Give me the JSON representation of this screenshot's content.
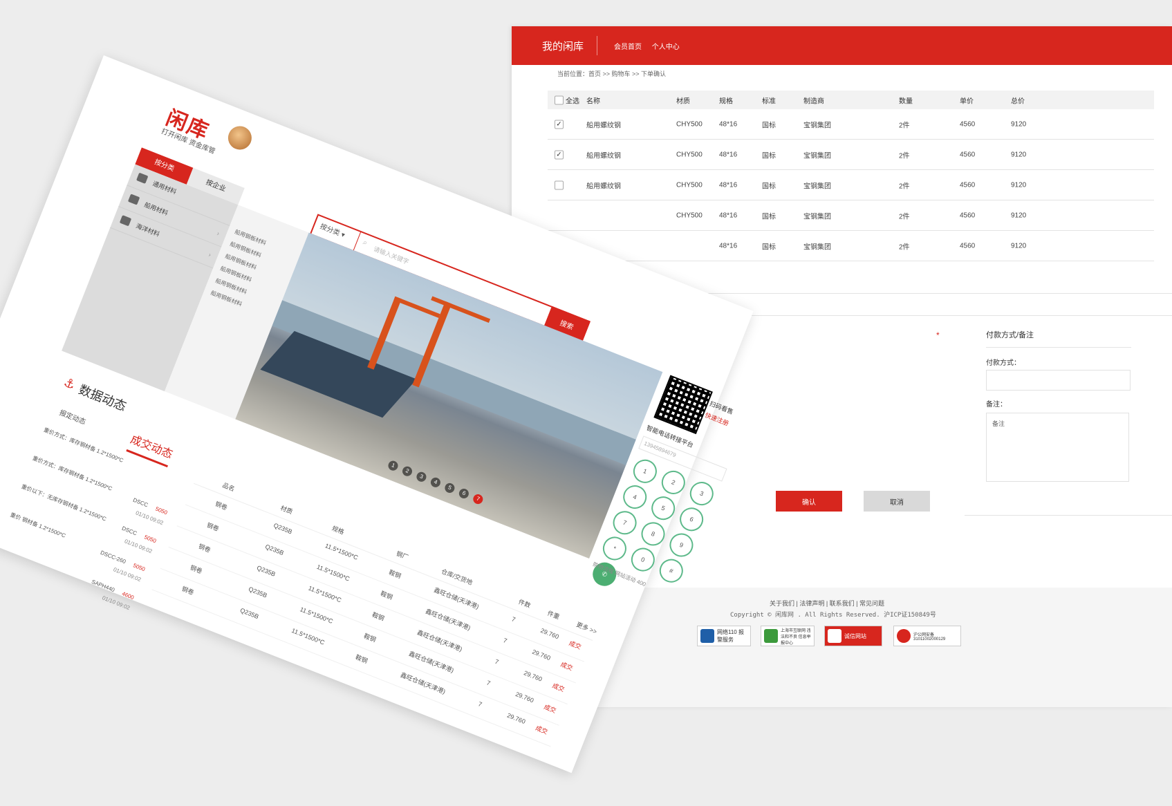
{
  "back": {
    "brand": "我的闲库",
    "nav": [
      "会员首页",
      "个人中心"
    ],
    "breadcrumb": "当前位置：首页 >> 购物车 >> 下单确认",
    "table": {
      "select_all": "全选",
      "headers": [
        "名称",
        "材质",
        "规格",
        "标准",
        "制造商",
        "数量",
        "单价",
        "总价"
      ],
      "rows": [
        {
          "checked": true,
          "name": "船用螺纹钢",
          "material": "CHY500",
          "spec": "48*16",
          "standard": "国标",
          "maker": "宝钢集团",
          "qty": "2件",
          "price": "4560",
          "total": "9120"
        },
        {
          "checked": true,
          "name": "船用螺纹钢",
          "material": "CHY500",
          "spec": "48*16",
          "standard": "国标",
          "maker": "宝钢集团",
          "qty": "2件",
          "price": "4560",
          "total": "9120"
        },
        {
          "checked": false,
          "name": "船用螺纹钢",
          "material": "CHY500",
          "spec": "48*16",
          "standard": "国标",
          "maker": "宝钢集团",
          "qty": "2件",
          "price": "4560",
          "total": "9120"
        },
        {
          "checked": false,
          "name": "",
          "material": "CHY500",
          "spec": "48*16",
          "standard": "国标",
          "maker": "宝钢集团",
          "qty": "2件",
          "price": "4560",
          "total": "9120"
        },
        {
          "checked": false,
          "name": "",
          "material": "",
          "spec": "48*16",
          "standard": "国标",
          "maker": "宝钢集团",
          "qty": "2件",
          "price": "4560",
          "total": "9120"
        }
      ]
    },
    "payment": {
      "title": "付款方式/备注",
      "method_label": "付款方式：",
      "note_label": "备注：",
      "note_placeholder": "备注",
      "confirm": "确认",
      "cancel": "取消",
      "required_mark": "*"
    },
    "footer": {
      "links": "关于我们 | 法律声明 | 联系我们 | 常见问题",
      "copyright": "Copyright © 闲库网 . All Rights Reserved. 沪ICP证150849号",
      "badges": [
        "网络110 报警服务",
        "上海市互联网 违法和不良 信息举报中心",
        "诚信网站",
        "沪公网安备 31011002000129"
      ]
    }
  },
  "front": {
    "logo": "闲库",
    "slogan": "打开闲库 资金库管",
    "tabs": [
      "按分类",
      "按企业"
    ],
    "categories": [
      "通用材料",
      "船用材料",
      "海洋材料"
    ],
    "sub_categories": [
      "船用钢板材料",
      "船用钢板材料",
      "船用钢板材料",
      "船用钢板材料",
      "船用钢板材料",
      "船用钢板材料"
    ],
    "search": {
      "category": "按分类",
      "placeholder": "请输入关键字",
      "button": "搜索"
    },
    "slider_dots": [
      "1",
      "2",
      "3",
      "4",
      "5",
      "6",
      "7"
    ],
    "qr": {
      "scan": "扫码看售",
      "register": "快速注册"
    },
    "phone": {
      "title": "智能电话转接平台",
      "placeholder": "13945894679",
      "keys": [
        "1",
        "2",
        "3",
        "4",
        "5",
        "6",
        "7",
        "8",
        "9",
        "*",
        "0",
        "#"
      ],
      "bottom": "购物流程  网站活动  400"
    },
    "dynamics": {
      "title": "数据动态",
      "tab_quote": "报定动态",
      "tab_deal": "成交动态",
      "feed": [
        {
          "text": "重价方式：库存钢材备 1.2*1500*C",
          "grade": "",
          "value": "",
          "date": ""
        },
        {
          "text": "重价方式：库存钢材备 1.2*1500*C",
          "grade": "DSCC",
          "value": "5050",
          "date": "01/10 09:02"
        },
        {
          "text": "重价以下：无库存钢材备 1.2*1500*C",
          "grade": "DSCC",
          "value": "5050",
          "date": "01/10 09:02"
        },
        {
          "text": "重价 钢材备 1.2*1500*C",
          "grade": "DSCC-260",
          "value": "5050",
          "date": "01/10 09:02"
        },
        {
          "text": "",
          "grade": "SAPH440",
          "value": "4600",
          "date": "01/10 09:02"
        }
      ],
      "list_headers": [
        "品名",
        "材质",
        "规格",
        "钢厂",
        "仓库/交货地",
        "件数",
        "件重",
        "更多 >>"
      ],
      "list_rows": [
        {
          "name": "钢卷",
          "mat": "Q235B",
          "spec": "11.5*1500*C",
          "mill": "鞍钢",
          "wh": "鑫旺仓储(天津港)",
          "pcs": "7",
          "wt": "29.760",
          "tag": "成交"
        },
        {
          "name": "钢卷",
          "mat": "Q235B",
          "spec": "11.5*1500*C",
          "mill": "鞍钢",
          "wh": "鑫旺仓储(天津港)",
          "pcs": "7",
          "wt": "29.760",
          "tag": "成交"
        },
        {
          "name": "钢卷",
          "mat": "Q235B",
          "spec": "11.5*1500*C",
          "mill": "鞍钢",
          "wh": "鑫旺仓储(天津港)",
          "pcs": "7",
          "wt": "29.760",
          "tag": "成交"
        },
        {
          "name": "钢卷",
          "mat": "Q235B",
          "spec": "11.5*1500*C",
          "mill": "鞍钢",
          "wh": "鑫旺仓储(天津港)",
          "pcs": "7",
          "wt": "29.760",
          "tag": "成交"
        },
        {
          "name": "钢卷",
          "mat": "Q235B",
          "spec": "11.5*1500*C",
          "mill": "鞍钢",
          "wh": "鑫旺仓储(天津港)",
          "pcs": "7",
          "wt": "29.760",
          "tag": "成交"
        }
      ]
    }
  },
  "colors": {
    "brand_red": "#d7261e",
    "call_green": "#4cae72"
  }
}
